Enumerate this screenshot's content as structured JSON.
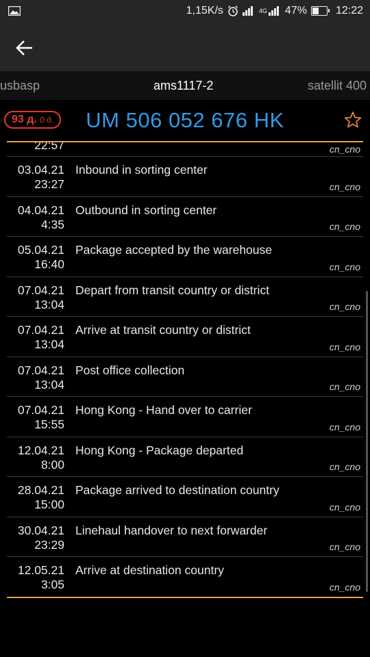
{
  "status_bar": {
    "net_speed": "1,15K/s",
    "network": "4G",
    "battery_percent": "47%",
    "battery_level": 0.47,
    "time": "12:22"
  },
  "tabs": [
    {
      "label": "usbasp",
      "active": false
    },
    {
      "label": "ams1117-2",
      "active": true
    },
    {
      "label": "satellit 400",
      "active": false
    }
  ],
  "header": {
    "days_main": "93 д.",
    "days_sub": "0 д.",
    "track_number": "UM 506 052 676 HK",
    "accent_color": "#2f9bea",
    "divider_color": "#e8a150"
  },
  "events": [
    {
      "date": "",
      "time": "22:57",
      "desc": "",
      "src": "cn_cno"
    },
    {
      "date": "03.04.21",
      "time": "23:27",
      "desc": "Inbound in sorting center",
      "src": "cn_cno"
    },
    {
      "date": "04.04.21",
      "time": "4:35",
      "desc": "Outbound in sorting center",
      "src": "cn_cno"
    },
    {
      "date": "05.04.21",
      "time": "16:40",
      "desc": "Package accepted by the warehouse",
      "src": "cn_cno"
    },
    {
      "date": "07.04.21",
      "time": "13:04",
      "desc": "Depart from transit country or district",
      "src": "cn_cno"
    },
    {
      "date": "07.04.21",
      "time": "13:04",
      "desc": "Arrive at transit country or district",
      "src": "cn_cno"
    },
    {
      "date": "07.04.21",
      "time": "13:04",
      "desc": "Post office collection",
      "src": "cn_cno"
    },
    {
      "date": "07.04.21",
      "time": "15:55",
      "desc": "Hong Kong - Hand over to carrier",
      "src": "cn_cno"
    },
    {
      "date": "12.04.21",
      "time": "8:00",
      "desc": "Hong Kong - Package departed",
      "src": "cn_cno"
    },
    {
      "date": "28.04.21",
      "time": "15:00",
      "desc": "Package arrived to destination country",
      "src": "cn_cno"
    },
    {
      "date": "30.04.21",
      "time": "23:29",
      "desc": "Linehaul handover to next forwarder",
      "src": "cn_cno"
    },
    {
      "date": "12.05.21",
      "time": "3:05",
      "desc": "Arrive at destination country",
      "src": "cn_cno"
    }
  ]
}
